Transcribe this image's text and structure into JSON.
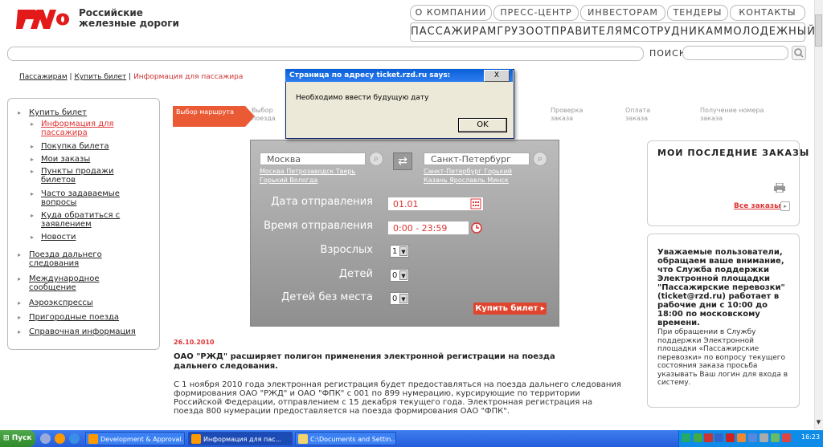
{
  "header": {
    "logo_line1": "Российские",
    "logo_line2": "железные дороги",
    "topnav": [
      "О КОМПАНИИ",
      "ПРЕСС-ЦЕНТР",
      "ИНВЕСТОРАМ",
      "ТЕНДЕРЫ",
      "КОНТАКТЫ"
    ],
    "mainnav": [
      "ПАССАЖИРАМ",
      "ГРУЗООТПРАВИТЕЛЯМ",
      "СОТРУДНИКАМ",
      "МОЛОДЕЖНЫЙ"
    ],
    "search_label": "ПОИСК"
  },
  "breadcrumb": {
    "items": [
      "Пассажирам",
      "Купить билет"
    ],
    "current": "Информация для пассажира",
    "sep": "|"
  },
  "sidebar": {
    "items": [
      {
        "label": "Купить билет"
      },
      {
        "label": "Информация для пассажира",
        "sub": true,
        "active": true
      },
      {
        "label": "Покупка билета",
        "sub": true
      },
      {
        "label": "Мои заказы",
        "sub": true
      },
      {
        "label": "Пункты продажи билетов",
        "sub": true
      },
      {
        "label": "Часто задаваемые вопросы",
        "sub": true
      },
      {
        "label": "Куда обратиться с заявлением",
        "sub": true
      },
      {
        "label": "Новости",
        "sub": true
      },
      {
        "label": "Поезда дальнего следования"
      },
      {
        "label": "Международное сообщение"
      },
      {
        "label": "Аэроэкспрессы"
      },
      {
        "label": "Пригородные поезда"
      },
      {
        "label": "Справочная информация"
      }
    ]
  },
  "steps": [
    {
      "label": "Выбор маршрута",
      "active": true
    },
    {
      "label": "Выбор поезда"
    },
    {
      "label": "Проверка заказа"
    },
    {
      "label": "Оплата заказа"
    },
    {
      "label": "Получение номера заказа"
    }
  ],
  "form": {
    "from_value": "Москва",
    "to_value": "Санкт-Петербург",
    "from_quick": [
      "Москва",
      "Петрозаводск",
      "Тверь",
      "Горький",
      "Вологда"
    ],
    "to_quick": [
      "Санкт-Петербург",
      "Горький",
      "Казань",
      "Ярославль",
      "Минск"
    ],
    "date_label": "Дата отправления",
    "date_value": "01.01",
    "time_label": "Время отправления",
    "time_value": "0:00 - 23:59",
    "adults_label": "Взрослых",
    "adults_value": "1",
    "children_label": "Детей",
    "children_value": "0",
    "infants_label": "Детей без места",
    "infants_value": "0",
    "buy_label": "Купить билет"
  },
  "news": {
    "date": "26.10.2010",
    "headline": "ОАО \"РЖД\" расширяет полигон применения электронной регистрации на поезда дальнего следования.",
    "body": "С 1 ноября 2010 года электронная регистрация будет предоставляться на поезда дальнего следования формирования ОАО \"РЖД\" и ОАО \"ФПК\" с 001 по 899 нумерацию, курсирующие по территории Российской Федерации, отправлением с 15 декабря текущего года. Электронная регистрация на поезда 800 нумерации предоставляется на поезда формирования ОАО \"ФПК\"."
  },
  "orders": {
    "title": "МОИ ПОСЛЕДНИЕ ЗАКАЗЫ",
    "all_link": "Все заказы"
  },
  "notice": {
    "bold": "Уважаемые пользователи, обращаем ваше внимание, что Служба поддержки Электронной площадки \"Пассажирские перевозки\" (ticket@rzd.ru) работает в рабочие дни с 10:00 до 18:00 по московскому времени.",
    "regular": "При обращении в Службу поддержки Электронной площадки «Пассажирские перевозки» по вопросу текущего состояния заказа просьба указывать Ваш логин для входа в систему."
  },
  "dialog": {
    "title": "Страница по адресу ticket.rzd.ru says:",
    "message": "Необходимо ввести будущую дату",
    "ok": "OK",
    "close": "X"
  },
  "taskbar": {
    "start": "Пуск",
    "tasks": [
      "Development & Approval...",
      "Информация для пас...",
      "C:\\Documents and Settin..."
    ],
    "clock": "16:23"
  },
  "colors": {
    "brand": "#e21a1a",
    "accent": "#ea5a35",
    "link_active": "#d33333"
  }
}
